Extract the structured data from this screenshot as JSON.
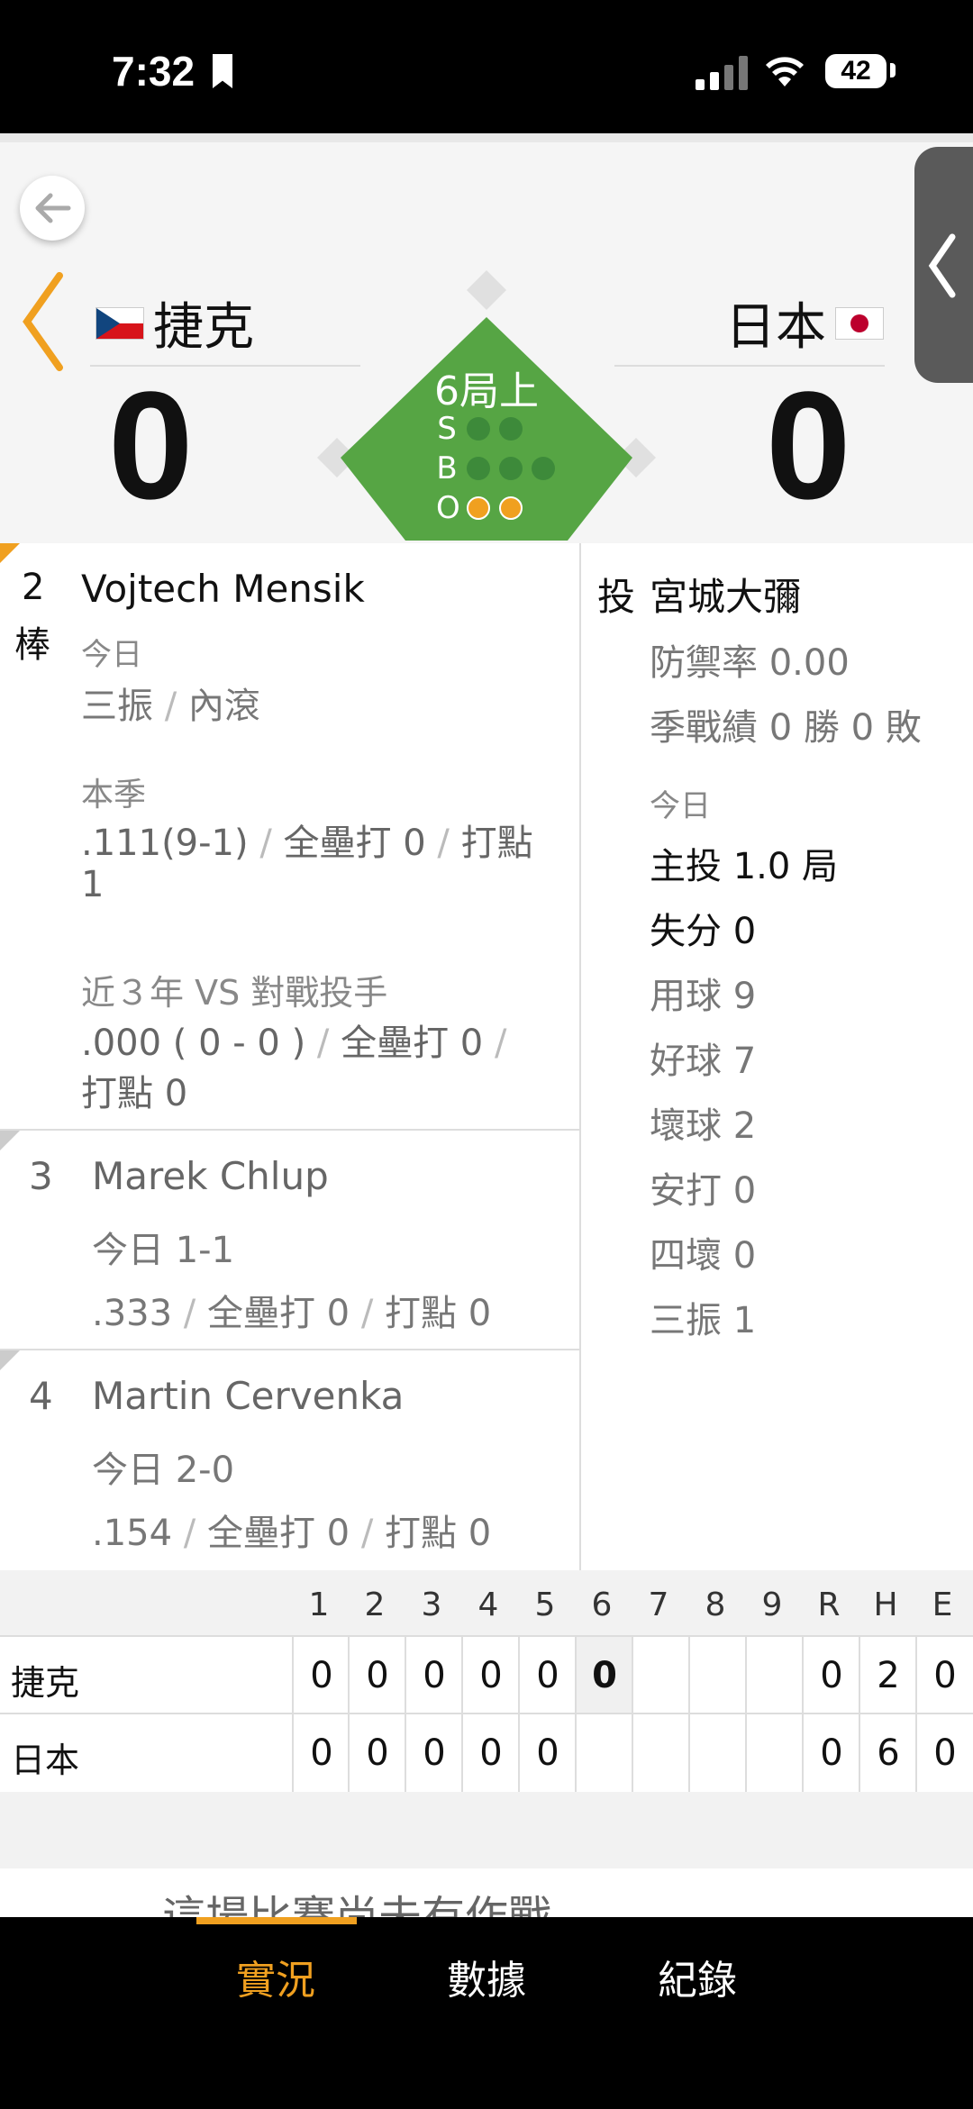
{
  "status_bar": {
    "time": "7:32",
    "battery": "42"
  },
  "game": {
    "away_team": "捷克",
    "home_team": "日本",
    "away_score": "0",
    "home_score": "0",
    "inning": "6局上",
    "count_labels": {
      "s": "S",
      "b": "B",
      "o": "O"
    },
    "strikes": 0,
    "balls": 0,
    "outs": 2
  },
  "batter": {
    "order": "2",
    "order_label": "棒",
    "name": "Vojtech Mensik",
    "today_label": "今日",
    "today_results": [
      "三振",
      "內滾"
    ],
    "season_label": "本季",
    "season_avg": ".111(9-1)",
    "season_hr": "全壘打 0",
    "season_rbi_label": "打點",
    "season_rbi": "1",
    "vs_label": "近３年 VS 對戰投手",
    "vs_avg": ".000 ( 0 - 0 )",
    "vs_hr": "全壘打 0",
    "vs_rbi": "打點 0"
  },
  "on_deck": [
    {
      "order": "3",
      "name": "Marek Chlup",
      "today": "今日 1-1",
      "avg": ".333",
      "hr": "全壘打 0",
      "rbi": "打點 0"
    },
    {
      "order": "4",
      "name": "Martin Cervenka",
      "today": "今日 2-0",
      "avg": ".154",
      "hr": "全壘打 0",
      "rbi": "打點 0"
    }
  ],
  "pitcher": {
    "label": "投",
    "name": "宮城大彌",
    "era": "防禦率 0.00",
    "record": "季戰績 0 勝 0 敗",
    "today_label": "今日",
    "innings": "主投 1.0 局",
    "runs": "失分 0",
    "pitches": "用球 9",
    "strikes": "好球 7",
    "balls": "壞球 2",
    "hits": "安打 0",
    "walks": "四壞 0",
    "strikeouts": "三振 1"
  },
  "linescore": {
    "headers": [
      "1",
      "2",
      "3",
      "4",
      "5",
      "6",
      "7",
      "8",
      "9",
      "R",
      "H",
      "E"
    ],
    "rows": [
      {
        "team": "捷克",
        "cells": [
          "0",
          "0",
          "0",
          "0",
          "0",
          "0",
          "",
          "",
          "",
          "0",
          "2",
          "0"
        ]
      },
      {
        "team": "日本",
        "cells": [
          "0",
          "0",
          "0",
          "0",
          "0",
          "",
          "",
          "",
          "",
          "0",
          "6",
          "0"
        ]
      }
    ]
  },
  "peek_text": "這場比賽尚未有作戰",
  "nav": {
    "tabs": [
      "實況",
      "數據",
      "紀錄"
    ]
  }
}
